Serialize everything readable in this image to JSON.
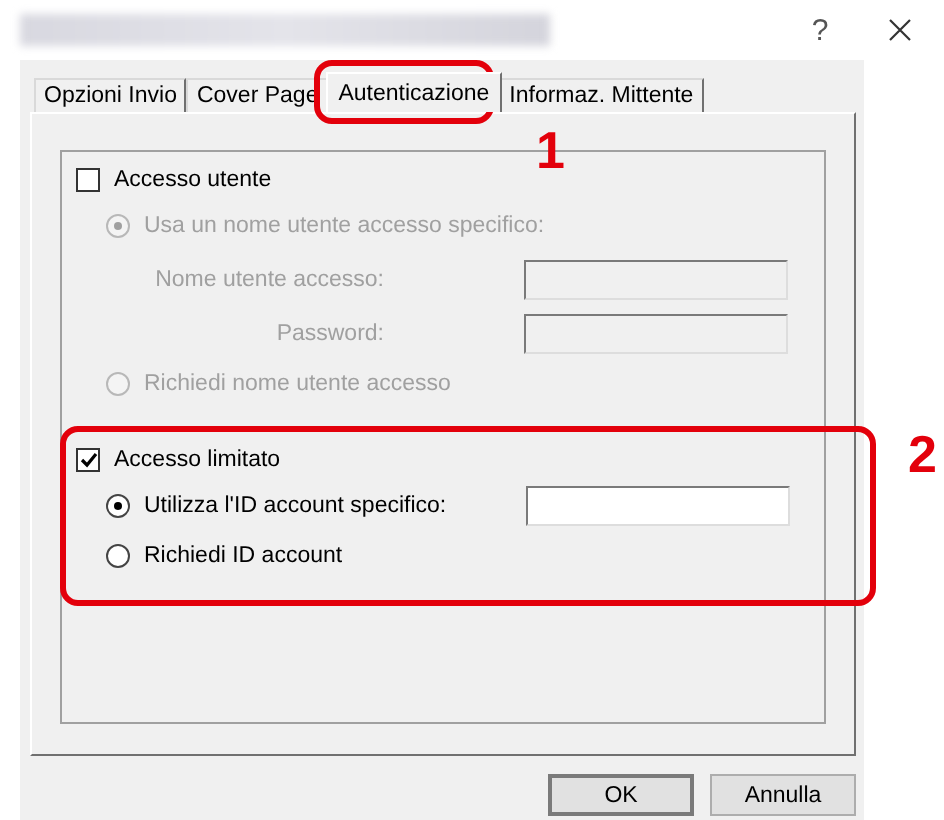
{
  "window": {
    "help": "?"
  },
  "tabs": [
    {
      "label": "Opzioni Invio",
      "selected": false
    },
    {
      "label": "Cover Page",
      "selected": false
    },
    {
      "label": "Autenticazione",
      "selected": true
    },
    {
      "label": "Informaz. Mittente",
      "selected": false
    }
  ],
  "sections": [
    {
      "label": "Accesso utente",
      "checked": false,
      "options": [
        {
          "kind": "radio-subfields",
          "label": "Usa un nome utente accesso specifico:",
          "selected": true,
          "disabled": true,
          "fields": [
            {
              "label": "Nome utente accesso:",
              "disabled": true
            },
            {
              "label": "Password:",
              "disabled": true
            }
          ]
        },
        {
          "kind": "radio",
          "label": "Richiedi nome utente accesso",
          "selected": false,
          "disabled": true
        }
      ]
    },
    {
      "label": "Accesso limitato",
      "checked": true,
      "options": [
        {
          "kind": "radio-inline-field",
          "label": "Utilizza l'ID account specifico:",
          "selected": true,
          "disabled": false
        },
        {
          "kind": "radio",
          "label": "Richiedi ID account",
          "selected": false,
          "disabled": false
        }
      ]
    }
  ],
  "buttons": [
    "OK",
    "Annulla"
  ],
  "annotations": [
    {
      "label": "1"
    },
    {
      "label": "2"
    }
  ]
}
